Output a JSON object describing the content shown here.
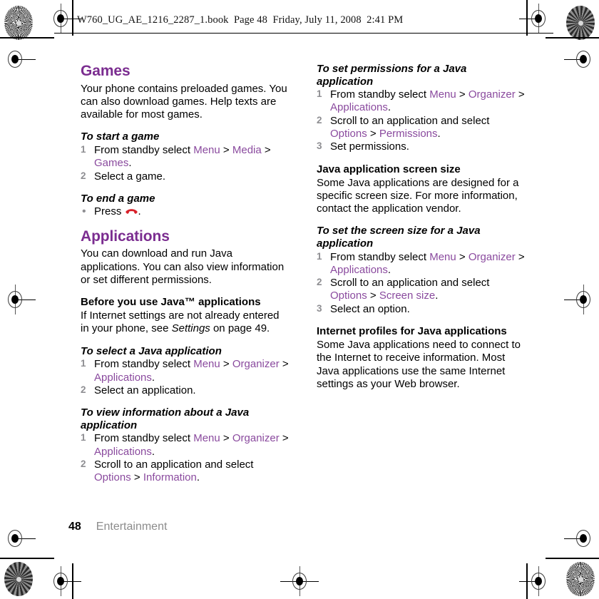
{
  "running_header": "W760_UG_AE_1216_2287_1.book  Page 48  Friday, July 11, 2008  2:41 PM",
  "colors": {
    "heading_purple": "#7b2d90",
    "link_purple": "#8a4a9e",
    "step_number_gray": "#8e8e92",
    "chapter_gray": "#8c8c8c",
    "endcall_red": "#d8212a"
  },
  "footer": {
    "page_number": "48",
    "chapter": "Entertainment"
  },
  "left_column": {
    "games_heading": "Games",
    "games_intro": "Your phone contains preloaded games. You can also download games. Help texts are available for most games.",
    "to_start_a_game": {
      "title": "To start a game",
      "steps": [
        {
          "num": "1",
          "parts": [
            {
              "t": "From standby select ",
              "k": "plain"
            },
            {
              "t": "Menu",
              "k": "link"
            },
            {
              "t": " > ",
              "k": "plain"
            },
            {
              "t": "Media",
              "k": "link"
            },
            {
              "t": " > ",
              "k": "plain"
            },
            {
              "t": "Games",
              "k": "link"
            },
            {
              "t": ".",
              "k": "plain"
            }
          ]
        },
        {
          "num": "2",
          "parts": [
            {
              "t": "Select a game.",
              "k": "plain"
            }
          ]
        }
      ]
    },
    "to_end_a_game": {
      "title": "To end a game",
      "bullet_prefix": "Press ",
      "bullet_icon": "end-call-icon",
      "bullet_suffix": "."
    },
    "applications_heading": "Applications",
    "applications_intro": "You can download and run Java applications. You can also view information or set different permissions.",
    "before_you_use": {
      "title": "Before you use Java™ applications",
      "text_before_italic": "If Internet settings are not already entered in your phone, see ",
      "italic_ref": "Settings",
      "text_after_italic": " on page 49."
    },
    "to_select_java_app": {
      "title": "To select a Java application",
      "steps": [
        {
          "num": "1",
          "parts": [
            {
              "t": "From standby select ",
              "k": "plain"
            },
            {
              "t": "Menu",
              "k": "link"
            },
            {
              "t": " > ",
              "k": "plain"
            },
            {
              "t": "Organizer",
              "k": "link"
            },
            {
              "t": " > ",
              "k": "plain"
            },
            {
              "t": "Applications",
              "k": "link"
            },
            {
              "t": ".",
              "k": "plain"
            }
          ]
        },
        {
          "num": "2",
          "parts": [
            {
              "t": "Select an application.",
              "k": "plain"
            }
          ]
        }
      ]
    },
    "to_view_info": {
      "title": "To view information about a Java application",
      "steps": [
        {
          "num": "1",
          "parts": [
            {
              "t": "From standby select ",
              "k": "plain"
            },
            {
              "t": "Menu",
              "k": "link"
            },
            {
              "t": " > ",
              "k": "plain"
            },
            {
              "t": "Organizer",
              "k": "link"
            },
            {
              "t": " > ",
              "k": "plain"
            },
            {
              "t": "Applications",
              "k": "link"
            },
            {
              "t": ".",
              "k": "plain"
            }
          ]
        },
        {
          "num": "2",
          "parts": [
            {
              "t": "Scroll to an application and select ",
              "k": "plain"
            },
            {
              "t": "Options",
              "k": "link"
            },
            {
              "t": " > ",
              "k": "plain"
            },
            {
              "t": "Information",
              "k": "link"
            },
            {
              "t": ".",
              "k": "plain"
            }
          ]
        }
      ]
    }
  },
  "right_column": {
    "to_set_permissions": {
      "title": "To set permissions for a Java application",
      "steps": [
        {
          "num": "1",
          "parts": [
            {
              "t": "From standby select ",
              "k": "plain"
            },
            {
              "t": "Menu",
              "k": "link"
            },
            {
              "t": " > ",
              "k": "plain"
            },
            {
              "t": "Organizer",
              "k": "link"
            },
            {
              "t": " > ",
              "k": "plain"
            },
            {
              "t": "Applications",
              "k": "link"
            },
            {
              "t": ".",
              "k": "plain"
            }
          ]
        },
        {
          "num": "2",
          "parts": [
            {
              "t": "Scroll to an application and select ",
              "k": "plain"
            },
            {
              "t": "Options",
              "k": "link"
            },
            {
              "t": " > ",
              "k": "plain"
            },
            {
              "t": "Permissions",
              "k": "link"
            },
            {
              "t": ".",
              "k": "plain"
            }
          ]
        },
        {
          "num": "3",
          "parts": [
            {
              "t": "Set permissions.",
              "k": "plain"
            }
          ]
        }
      ]
    },
    "screen_size": {
      "title": "Java application screen size",
      "text": "Some Java applications are designed for a specific screen size. For more information, contact the application vendor."
    },
    "to_set_screen_size": {
      "title": "To set the screen size for a Java application",
      "steps": [
        {
          "num": "1",
          "parts": [
            {
              "t": "From standby select ",
              "k": "plain"
            },
            {
              "t": "Menu",
              "k": "link"
            },
            {
              "t": " > ",
              "k": "plain"
            },
            {
              "t": "Organizer",
              "k": "link"
            },
            {
              "t": " > ",
              "k": "plain"
            },
            {
              "t": "Applications",
              "k": "link"
            },
            {
              "t": ".",
              "k": "plain"
            }
          ]
        },
        {
          "num": "2",
          "parts": [
            {
              "t": "Scroll to an application and select ",
              "k": "plain"
            },
            {
              "t": "Options",
              "k": "link"
            },
            {
              "t": " > ",
              "k": "plain"
            },
            {
              "t": "Screen size",
              "k": "link"
            },
            {
              "t": ".",
              "k": "plain"
            }
          ]
        },
        {
          "num": "3",
          "parts": [
            {
              "t": "Select an option.",
              "k": "plain"
            }
          ]
        }
      ]
    },
    "internet_profiles": {
      "title": "Internet profiles for Java applications",
      "text": "Some Java applications need to connect to the Internet to receive information. Most Java applications use the same Internet settings as your Web browser."
    }
  }
}
